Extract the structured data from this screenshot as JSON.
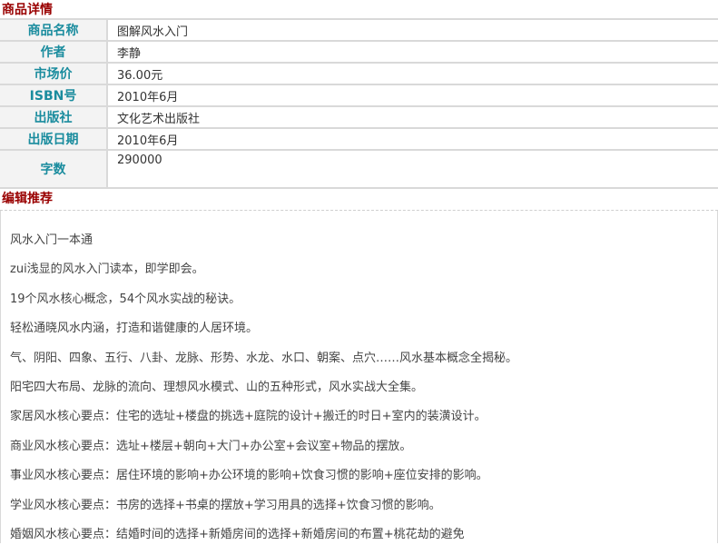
{
  "details_header": "商品详情",
  "details": [
    {
      "label": "商品名称",
      "value": "图解风水入门"
    },
    {
      "label": "作者",
      "value": "李静"
    },
    {
      "label": "市场价",
      "value": "36.00元"
    },
    {
      "label": "ISBN号",
      "value": "2010年6月"
    },
    {
      "label": "出版社",
      "value": "文化艺术出版社"
    },
    {
      "label": "出版日期",
      "value": "2010年6月"
    },
    {
      "label": "字数",
      "value": "290000"
    }
  ],
  "recommend_header": "编辑推荐",
  "recommend_lines": [
    "风水入门一本通",
    "zui浅显的风水入门读本，即学即会。",
    "19个风水核心概念，54个风水实战的秘诀。",
    "轻松通晓风水内涵，打造和谐健康的人居环境。",
    "气、阴阳、四象、五行、八卦、龙脉、形势、水龙、水口、朝案、点穴……风水基本概念全揭秘。",
    "阳宅四大布局、龙脉的流向、理想风水模式、山的五种形式，风水实战大全集。",
    "家居风水核心要点：住宅的选址+楼盘的挑选+庭院的设计+搬迁的时日+室内的装潢设计。",
    "商业风水核心要点：选址+楼层+朝向+大门+办公室+会议室+物品的摆放。",
    "事业风水核心要点：居住环境的影响+办公环境的影响+饮食习惯的影响+座位安排的影响。",
    "学业风水核心要点：书房的选择+书桌的摆放+学习用具的选择+饮食习惯的影响。",
    "婚姻风水核心要点：结婚时间的选择+新婚房间的选择+新婚房间的布置+桃花劫的避免"
  ]
}
